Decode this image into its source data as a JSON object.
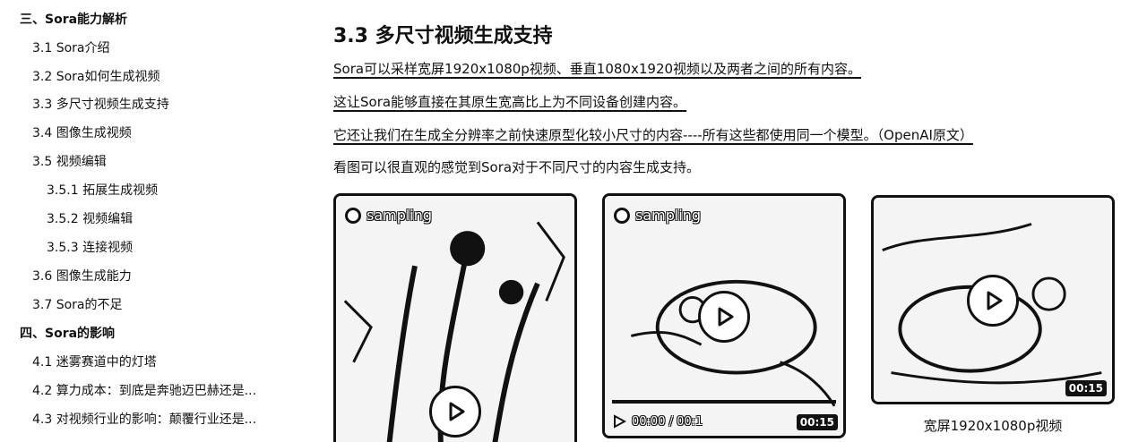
{
  "toc": [
    {
      "label": "三、Sora能力解析",
      "level": 1
    },
    {
      "label": "3.1 Sora介绍",
      "level": 2
    },
    {
      "label": "3.2 Sora如何生成视频",
      "level": 2
    },
    {
      "label": "3.3 多尺寸视频生成支持",
      "level": 2
    },
    {
      "label": "3.4 图像生成视频",
      "level": 2
    },
    {
      "label": "3.5 视频编辑",
      "level": 2
    },
    {
      "label": "3.5.1 拓展生成视频",
      "level": 3
    },
    {
      "label": "3.5.2 视频编辑",
      "level": 3
    },
    {
      "label": "3.5.3 连接视频",
      "level": 3
    },
    {
      "label": "3.6 图像生成能力",
      "level": 2
    },
    {
      "label": "3.7 Sora的不足",
      "level": 2
    },
    {
      "label": "四、Sora的影响",
      "level": 1
    },
    {
      "label": "4.1 迷雾赛道中的灯塔",
      "level": 2
    },
    {
      "label": "4.2 算力成本：到底是奔驰迈巴赫还是...",
      "level": 2
    },
    {
      "label": "4.3 对视频行业的影响：颠覆行业还是...",
      "level": 2
    }
  ],
  "article": {
    "heading": "3.3 多尺寸视频生成支持",
    "paragraphs": [
      "Sora可以采样宽屏1920x1080p视频、垂直1080x1920视频以及两者之间的所有内容。",
      "这让Sora能够直接在其原生宽高比上为不同设备创建内容。",
      "它还让我们在生成全分辨率之前快速原型化较小尺寸的内容----所有这些都使用同一个模型。（OpenAI原文）",
      "看图可以很直观的感觉到Sora对于不同尺寸的内容生成支持。"
    ]
  },
  "videos": [
    {
      "badge": "sampling",
      "duration": "",
      "progress": 0
    },
    {
      "badge": "sampling",
      "time": "00:00 / 00:1",
      "duration": "00:15",
      "progress": 0
    },
    {
      "badge": "",
      "duration": "00:15",
      "caption": "宽屏1920x1080p视频",
      "progress": 0
    }
  ],
  "colors": {
    "text": "#111111",
    "background": "#ffffff",
    "frame": "#111111"
  },
  "icons": {
    "play": "play-icon",
    "sampling": "sampling-icon"
  }
}
